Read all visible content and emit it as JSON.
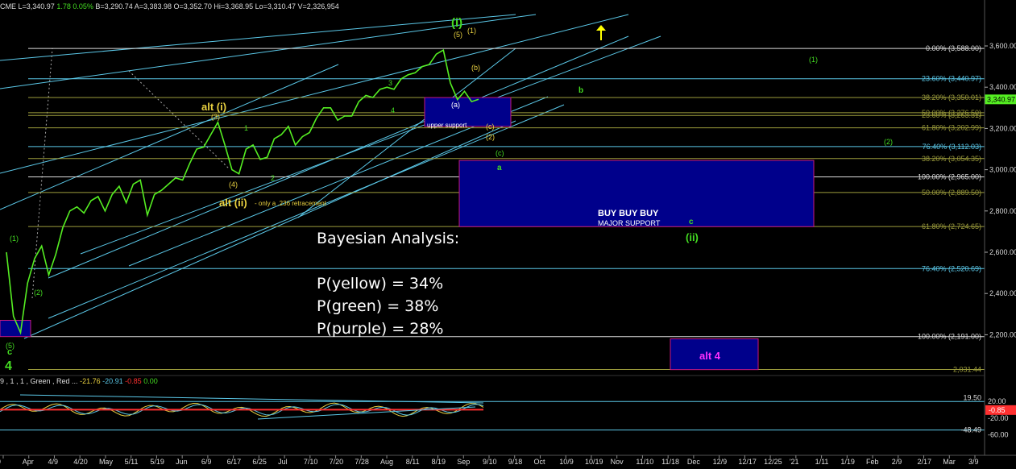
{
  "header": {
    "symbol": "CME",
    "last": "L=3,340.97",
    "change": "1.78",
    "change_pct": "0.05%",
    "bid": "B=3,290.74",
    "ask": "A=3,383.98",
    "open": "O=3,352.70",
    "high": "Hi=3,368.95",
    "low": "Lo=3,310.47",
    "volume": "V=2,326,954"
  },
  "indicator_header": {
    "params": "9 , 1 , 1 , Green , Red ...",
    "v1": "-21.76",
    "v2": "-20.91",
    "v3": "-0.85",
    "v4": "0.00"
  },
  "bayesian": {
    "title": "Bayesian Analysis:",
    "p_yellow": "P(yellow) = 34%",
    "p_green": "P(green) =  38%",
    "p_purple": "P(purple) = 28%"
  },
  "colors": {
    "background": "#000000",
    "price": "#55ee22",
    "channel": "#5bc8e8",
    "fib": "#9c9c3c",
    "box": "#00008b",
    "box_border": "#c8187e",
    "yellow_label": "#e8d040",
    "green_label": "#44dd22",
    "alt4": "#ff30ff"
  },
  "chart_data": {
    "type": "line",
    "title": "",
    "xlabel": "",
    "ylabel": "",
    "ylim": [
      1990,
      3720
    ],
    "y_ticks": [
      "3,600.00",
      "3,400.00",
      "3,200.00",
      "3,000.00",
      "2,800.00",
      "2,600.00",
      "2,400.00",
      "2,200.00"
    ],
    "y_tick_values": [
      3600,
      3400,
      3200,
      3000,
      2800,
      2600,
      2400,
      2200
    ],
    "x_ticks": [
      "9",
      "Apr",
      "4/9",
      "4/20",
      "May",
      "5/11",
      "5/19",
      "Jun",
      "6/9",
      "6/17",
      "6/25",
      "Jul",
      "7/10",
      "7/20",
      "7/28",
      "Aug",
      "8/11",
      "8/19",
      "Sep",
      "9/10",
      "9/18",
      "Oct",
      "10/9",
      "10/19",
      "Nov",
      "11/10",
      "11/18",
      "Dec",
      "12/9",
      "12/17",
      "12/25",
      "'21",
      "1/11",
      "1/19",
      "Feb",
      "2/9",
      "2/17",
      "Mar",
      "3/9"
    ],
    "last_value": "3,340.97",
    "series": [
      {
        "values": [
          2600,
          2290,
          2210,
          2450,
          2570,
          2630,
          2490,
          2590,
          2720,
          2800,
          2820,
          2790,
          2850,
          2870,
          2800,
          2880,
          2920,
          2840,
          2930,
          2950,
          2780,
          2880,
          2900,
          2930,
          2960,
          2950,
          3030,
          3100,
          3110,
          3170,
          3230,
          3120,
          3000,
          2980,
          3100,
          3120,
          3050,
          3060,
          3150,
          3170,
          3210,
          3120,
          3160,
          3180,
          3250,
          3300,
          3300,
          3240,
          3260,
          3260,
          3330,
          3360,
          3350,
          3390,
          3400,
          3390,
          3440,
          3460,
          3470,
          3500,
          3510,
          3560,
          3580,
          3420,
          3340,
          3380,
          3330,
          3341
        ]
      }
    ],
    "fib_levels": [
      {
        "label": "0.00% (3,588.00)",
        "value": 3588
      },
      {
        "label": "23.60% (3,440.97)",
        "value": 3441
      },
      {
        "label": "38.20% (3,350.01)",
        "value": 3350
      },
      {
        "label": "50.00% (3,276.50)",
        "value": 3276.5
      },
      {
        "label": "23.60% (3,263.31)",
        "value": 3263.3
      },
      {
        "label": "61.80% (3,202.99)",
        "value": 3203
      },
      {
        "label": "76.40% (3,112.03)",
        "value": 3112
      },
      {
        "label": "38.20% (3,054.35)",
        "value": 3054
      },
      {
        "label": "100.00% (2,965.00)",
        "value": 2965
      },
      {
        "label": "50.00% (2,889.50)",
        "value": 2889.5
      },
      {
        "label": "61.80% (2,724.65)",
        "value": 2724.65
      },
      {
        "label": "76.40% (2,520.69)",
        "value": 2520.69
      },
      {
        "label": "100.00% (2,191.00)",
        "value": 2191
      },
      {
        "label": "2,031.44",
        "value": 2031.44
      }
    ],
    "boxes": [
      {
        "label": "upper support",
        "value_top": 3350,
        "value_bottom": 3210
      },
      {
        "label": "BUY BUY BUY",
        "sublabel": "MAJOR SUPPORT",
        "value_top": 3045,
        "value_bottom": 2724
      },
      {
        "label": "alt 4",
        "value_top": 2180,
        "value_bottom": 2031
      },
      {
        "label": "",
        "value_top": 2270,
        "value_bottom": 2191
      }
    ],
    "wave_labels_yellow": [
      "alt (i)",
      "alt (ii)",
      "- only a .236 retracement",
      "(3)",
      "(4)",
      "(1)",
      "(b)",
      "(2)",
      "(c)",
      "(5)"
    ],
    "wave_labels_green": [
      "(i)",
      "(5)",
      "(1)",
      "b",
      "(2)",
      "a",
      "c",
      "(ii)",
      "(c)",
      "(a)",
      "1",
      "2",
      "3",
      "4",
      "c",
      "4",
      "(5)",
      "(1)",
      "(2)"
    ],
    "indicator": {
      "y_ticks": [
        "20.00",
        "-20.00",
        "-60.00"
      ],
      "y_tick_values": [
        20,
        -20,
        -60
      ],
      "labels": [
        "19.50",
        "-0.85",
        "-48.49"
      ]
    }
  }
}
